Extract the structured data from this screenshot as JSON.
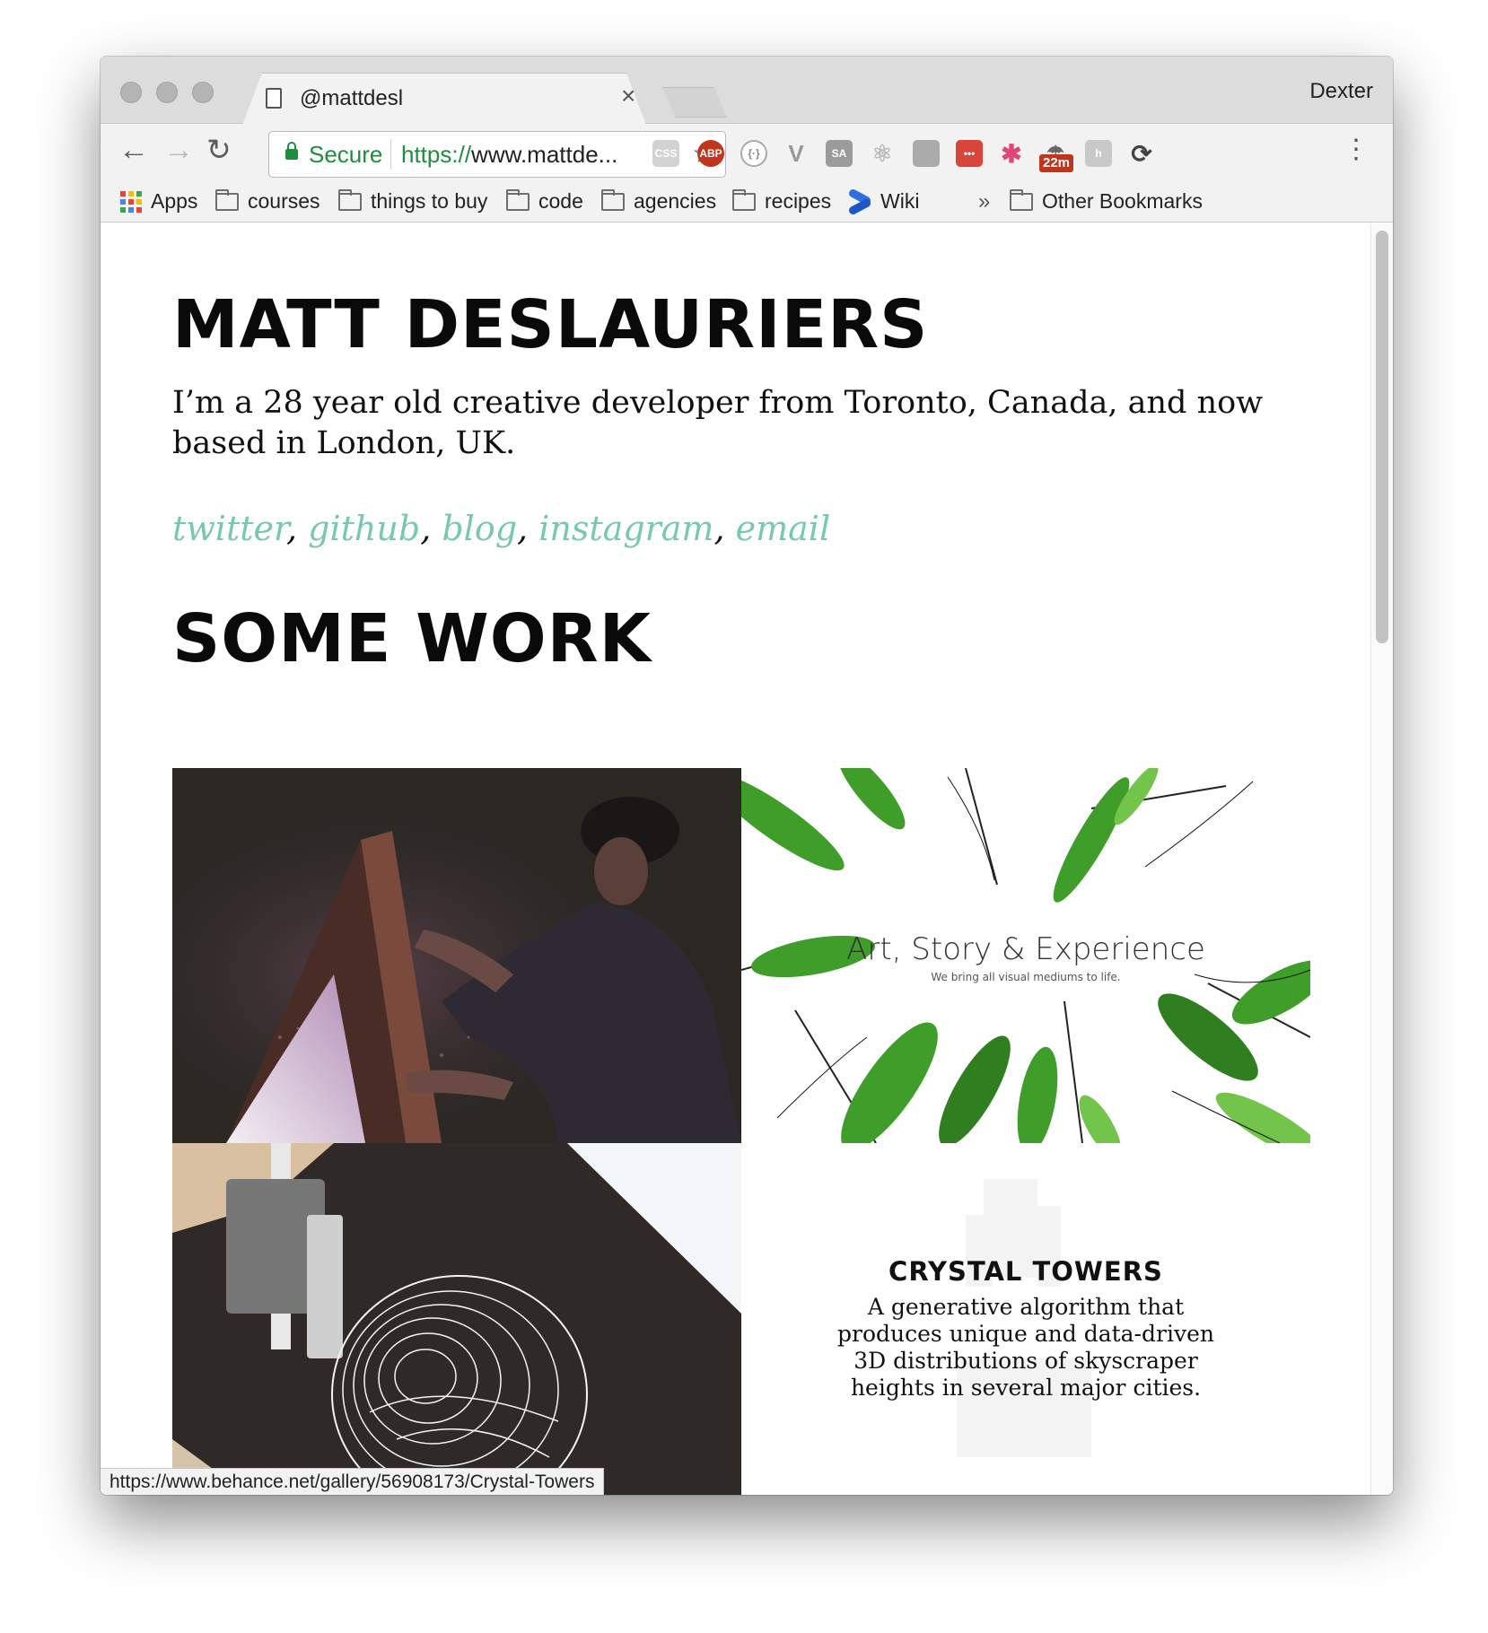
{
  "browser": {
    "tab_title": "@mattdesl",
    "tab_close": "×",
    "profile_name": "Dexter",
    "security_label": "Secure",
    "url_scheme": "https://",
    "url_rest": "www.mattde...",
    "status_url": "https://www.behance.net/gallery/56908173/Crystal-Towers",
    "ext_badge": "22m",
    "bookmarks": [
      {
        "label": "Apps",
        "icon": "apps-grid-icon"
      },
      {
        "label": "courses",
        "icon": "folder-icon"
      },
      {
        "label": "things to buy",
        "icon": "folder-icon"
      },
      {
        "label": "code",
        "icon": "folder-icon"
      },
      {
        "label": "agencies",
        "icon": "folder-icon"
      },
      {
        "label": "recipes",
        "icon": "folder-icon"
      },
      {
        "label": "Wiki",
        "icon": "confluence-icon"
      },
      {
        "label": "Other Bookmarks",
        "icon": "folder-icon"
      }
    ],
    "overflow_chevron": "»"
  },
  "page": {
    "name": "MATT DESLAURIERS",
    "intro": "I’m a 28 year old creative developer from Toronto, Canada, and now based in London, UK.",
    "links": [
      "twitter",
      "github",
      "blog",
      "instagram",
      "email"
    ],
    "work_heading": "SOME WORK",
    "tiles": {
      "art_title": "Art, Story & Experience",
      "art_subtitle": "We bring all visual mediums to life.",
      "crystal_title": "CRYSTAL TOWERS",
      "crystal_desc": "A generative algorithm that produces unique and data-driven 3D distributions of skyscraper heights in several major cities."
    }
  },
  "colors": {
    "link": "#76c9b0",
    "secure_green": "#1e8e3e",
    "heading": "#0a0a0a"
  }
}
